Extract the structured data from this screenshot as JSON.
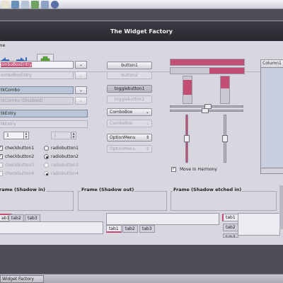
{
  "window": {
    "title": "The Widget Factory"
  },
  "menubar": {
    "menu_file": "me"
  },
  "icons": {
    "back": "go-back-icon",
    "forward": "go-forward-icon",
    "add": "add-icon"
  },
  "entries": {
    "combo_entry": "omboBoxEntry",
    "combo_entry_disabled": "omboBoxEntry",
    "gtk_combo": "tkCombo",
    "gtk_combo_disabled": "tkCombo (Disabled)",
    "text_entry": "tkEntry",
    "text_entry_disabled": "tkEntry"
  },
  "spinners": {
    "spin1": "1",
    "spin2": "1"
  },
  "checks": [
    {
      "label": "checkbutton1",
      "checked": true
    },
    {
      "label": "checkbutton2",
      "checked": true
    },
    {
      "label": "checkbutton3",
      "checked": false
    },
    {
      "label": "checkbutton4",
      "checked": false
    }
  ],
  "radios": [
    {
      "label": "radiobutton1",
      "checked": false
    },
    {
      "label": "radiobutton2",
      "checked": true
    },
    {
      "label": "radiobutton3",
      "checked": false
    },
    {
      "label": "radiobutton4",
      "checked": true
    }
  ],
  "buttons": {
    "button1": "button1",
    "button2": "button2",
    "toggle1": "togglebutton1",
    "toggle2": "togglebutton2",
    "combobox1": "ComboBox",
    "combobox2": "ComboBox",
    "option1": "OptionMenu",
    "option2": "OptionMenu"
  },
  "harmony_label": "Move In Harmony",
  "tree": {
    "column": "Column1"
  },
  "frames": {
    "shadow_in": "rame (Shadow in)",
    "shadow_out": "Frame (Shadow out)",
    "shadow_etched": "Frame (Shadow etched in)"
  },
  "tabs": {
    "group1": [
      "ab1",
      "tab2",
      "tab3"
    ],
    "group2": [
      "tab1",
      "tab2",
      "tab3"
    ],
    "group3": [
      "tab1",
      "tab2",
      "tab3"
    ]
  },
  "taskbar": {
    "button": "Widget Factory"
  },
  "colors": {
    "accent": "#c24e73",
    "window_bg": "#d8d6df",
    "titlebar": "#2f2e35"
  }
}
